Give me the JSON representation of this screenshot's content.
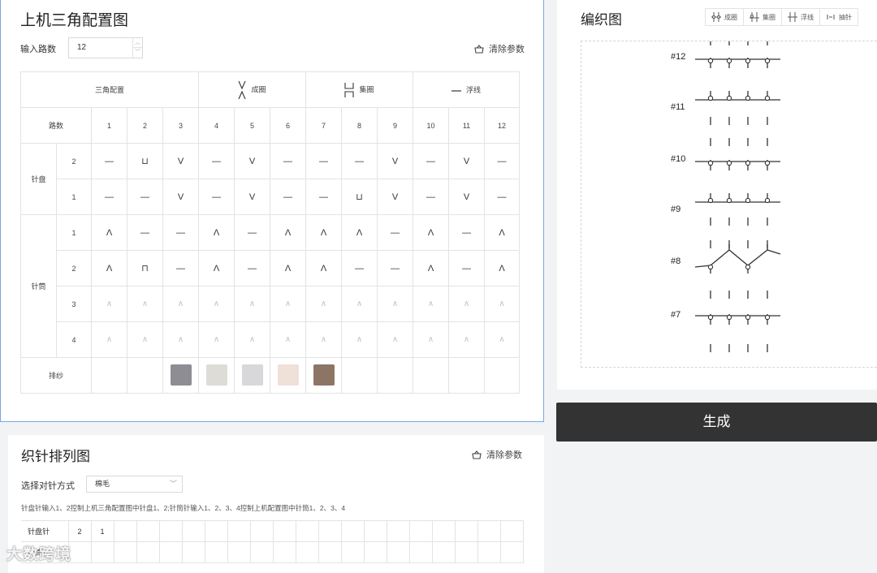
{
  "config": {
    "title": "上机三角配置图",
    "route_label": "输入路数",
    "route_value": "12",
    "clear_label": "清除参数",
    "header": {
      "config": "三角配置",
      "knit": "成圈",
      "tuck": "集圈",
      "float": "浮线"
    },
    "lane_label": "路数",
    "lanes": [
      "1",
      "2",
      "3",
      "4",
      "5",
      "6",
      "7",
      "8",
      "9",
      "10",
      "11",
      "12"
    ],
    "dial_label": "针盘",
    "cylinder_label": "针筒",
    "yarn_label": "排纱",
    "rows": [
      {
        "num": "2",
        "cells": [
          "—",
          "⊔",
          "V",
          "—",
          "V",
          "—",
          "—",
          "—",
          "V",
          "—",
          "V",
          "—"
        ]
      },
      {
        "num": "1",
        "cells": [
          "—",
          "—",
          "V",
          "—",
          "V",
          "—",
          "—",
          "⊔",
          "V",
          "—",
          "V",
          "—"
        ]
      },
      {
        "num": "1",
        "cells": [
          "Λ",
          "—",
          "—",
          "Λ",
          "—",
          "Λ",
          "Λ",
          "Λ",
          "—",
          "Λ",
          "—",
          "Λ"
        ]
      },
      {
        "num": "2",
        "cells": [
          "Λ",
          "⊓",
          "—",
          "Λ",
          "—",
          "Λ",
          "Λ",
          "—",
          "—",
          "Λ",
          "—",
          "Λ"
        ]
      },
      {
        "num": "3",
        "cells": [
          "∧",
          "∧",
          "∧",
          "∧",
          "∧",
          "∧",
          "∧",
          "∧",
          "∧",
          "∧",
          "∧",
          "∧"
        ]
      },
      {
        "num": "4",
        "cells": [
          "∧",
          "∧",
          "∧",
          "∧",
          "∧",
          "∧",
          "∧",
          "∧",
          "∧",
          "∧",
          "∧",
          "∧"
        ]
      }
    ],
    "yarn_colors": [
      "",
      "",
      "#8d8d93",
      "#dedcd7",
      "#d8d8da",
      "#efe0d8",
      "#8d7565",
      "",
      "",
      "",
      "",
      ""
    ]
  },
  "knit": {
    "title": "编织图",
    "tools": [
      "成圈",
      "集圈",
      "浮线",
      "抽针"
    ],
    "rows": [
      "#12",
      "#11",
      "#10",
      "#9",
      "#8",
      "#7"
    ]
  },
  "generate_label": "生成",
  "needle": {
    "title": "织针排列图",
    "clear_label": "清除参数",
    "method_label": "选择对针方式",
    "method_value": "棉毛",
    "hint": "针盘针输入1、2控制上机三角配置图中针盘1、2;针筒针输入1、2、3、4控制上机配置图中针筒1、2、3、4",
    "dial_label": "针盘针",
    "dial_values": [
      "2",
      "1"
    ],
    "cyl_label": "针筒针"
  },
  "watermark": "大数跨境"
}
